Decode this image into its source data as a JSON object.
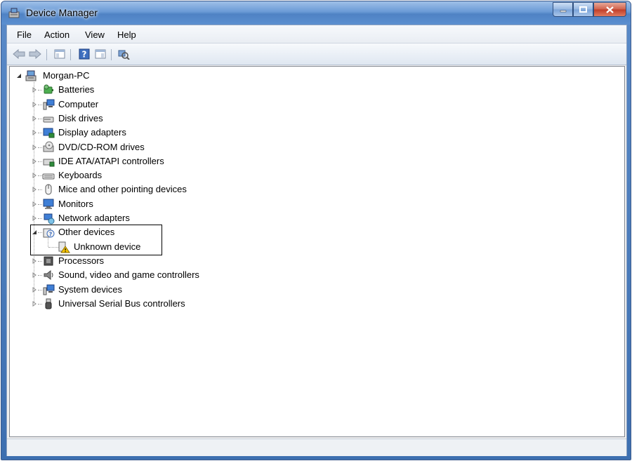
{
  "window": {
    "title": "Device Manager"
  },
  "menu": [
    "File",
    "Action",
    "View",
    "Help"
  ],
  "toolbar": [
    "back-icon",
    "forward-icon",
    "show-hide-console-tree-icon",
    "help-icon",
    "properties-icon",
    "scan-hardware-icon"
  ],
  "tree": {
    "root": "Morgan-PC",
    "categories": [
      {
        "label": "Batteries",
        "icon": "battery-icon"
      },
      {
        "label": "Computer",
        "icon": "computer-icon"
      },
      {
        "label": "Disk drives",
        "icon": "disk-drive-icon"
      },
      {
        "label": "Display adapters",
        "icon": "display-adapter-icon"
      },
      {
        "label": "DVD/CD-ROM drives",
        "icon": "dvd-drive-icon"
      },
      {
        "label": "IDE ATA/ATAPI controllers",
        "icon": "ide-controller-icon"
      },
      {
        "label": "Keyboards",
        "icon": "keyboard-icon"
      },
      {
        "label": "Mice and other pointing devices",
        "icon": "mouse-icon"
      },
      {
        "label": "Monitors",
        "icon": "monitor-icon"
      },
      {
        "label": "Network adapters",
        "icon": "network-adapter-icon"
      },
      {
        "label": "Other devices",
        "icon": "other-devices-icon",
        "expanded": true,
        "children": [
          {
            "label": "Unknown device",
            "icon": "warning-device-icon"
          }
        ]
      },
      {
        "label": "Processors",
        "icon": "processor-icon"
      },
      {
        "label": "Sound, video and game controllers",
        "icon": "speaker-icon"
      },
      {
        "label": "System devices",
        "icon": "system-devices-icon"
      },
      {
        "label": "Universal Serial Bus controllers",
        "icon": "usb-icon"
      }
    ]
  },
  "status": ""
}
